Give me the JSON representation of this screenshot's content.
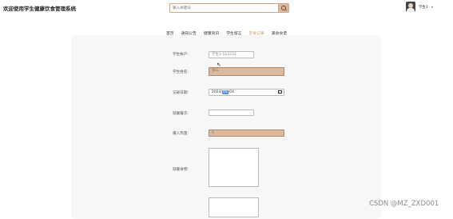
{
  "header": {
    "site_title": "欢迎使用学生健康饮食管理系统",
    "search": {
      "placeholder": "输入关键词",
      "icon": "search-icon"
    },
    "user": {
      "name": "学生2",
      "caret": "▾",
      "avatar_icon": "avatar"
    }
  },
  "nav": {
    "items": [
      {
        "label": "首页",
        "active": false
      },
      {
        "label": "通知公告",
        "active": false
      },
      {
        "label": "健康资讯",
        "active": false
      },
      {
        "label": "学生留言",
        "active": false
      },
      {
        "label": "饮食记录",
        "active": true
      },
      {
        "label": "美食食谱",
        "active": false
      }
    ],
    "active_color": "#c99a57"
  },
  "form": {
    "account": {
      "label": "学生帐户:",
      "value": "学生2-112233"
    },
    "name": {
      "label": "学生姓名:",
      "value": "张三"
    },
    "date": {
      "label": "记录日期:",
      "year": "2024",
      "month": "05",
      "day": "04",
      "sep": "/"
    },
    "meal_count": {
      "label": "就餐餐次:",
      "value": ""
    },
    "calories": {
      "label": "摄入热量:",
      "value": "0"
    },
    "diet_food": {
      "label": "就餐食物:",
      "value": ""
    },
    "extra": {
      "value": ""
    }
  },
  "colors": {
    "tan_field": "#dcb89c",
    "panel": "#f7f7f7"
  },
  "watermark": "CSDN @MZ_ZXD001"
}
